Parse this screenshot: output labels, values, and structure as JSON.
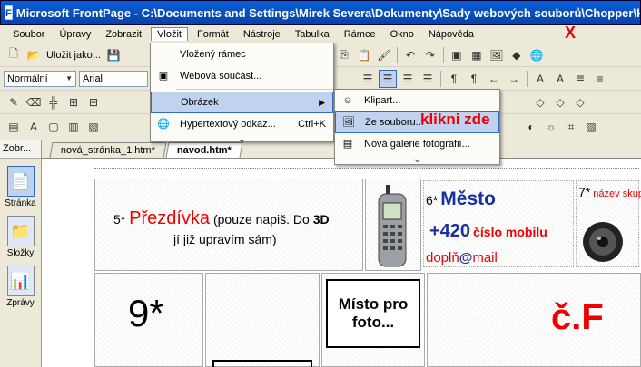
{
  "window": {
    "title": "Microsoft FrontPage - C:\\Documents and Settings\\Mirek Severa\\Dokumenty\\Sady webových souborů\\Chopper\\k"
  },
  "menu": {
    "items": [
      "Soubor",
      "Úpravy",
      "Zobrazit",
      "Vložit",
      "Formát",
      "Nástroje",
      "Tabulka",
      "Rámce",
      "Okno",
      "Nápověda"
    ],
    "close_annotation": "X"
  },
  "toolbar1": {
    "save_label": "Uložit jako..."
  },
  "toolbar2": {
    "style_value": "Normální",
    "font_value": "Arial"
  },
  "left_panel": {
    "title": "Zobr...",
    "views": [
      {
        "label": "Stránka",
        "icon": "page-icon"
      },
      {
        "label": "Složky",
        "icon": "folders-icon"
      },
      {
        "label": "Zprávy",
        "icon": "reports-icon"
      }
    ]
  },
  "tabs": [
    "nová_stránka_1.htm*",
    "navod.htm*"
  ],
  "insert_menu": {
    "items": [
      "Vložený rámec",
      "Webová součást...",
      "Obrázek",
      "Hypertextový odkaz...",
      "Ctrl+K"
    ]
  },
  "picture_submenu": {
    "items": [
      "Klipart...",
      "Ze souboru...",
      "Nová galerie fotografií..."
    ],
    "annotation": "klikni zde"
  },
  "page": {
    "nick_num": "5*",
    "nick_title": "Přezdívka",
    "nick_note_1": "(pouze napiš. Do",
    "nick_note_bold": "3D",
    "nick_note_2": "jí již upravím sám)",
    "city_num": "6*",
    "city": "Město",
    "phone_prefix": "+420",
    "phone_label": "číslo mobilu",
    "mail_before": "doplň",
    "mail_at": "@",
    "mail_after": "mail",
    "group_num": "7*",
    "group_label": "název skupiny",
    "cell9": "9*",
    "photo": "Místo pro foto...",
    "cF": "č.F"
  }
}
